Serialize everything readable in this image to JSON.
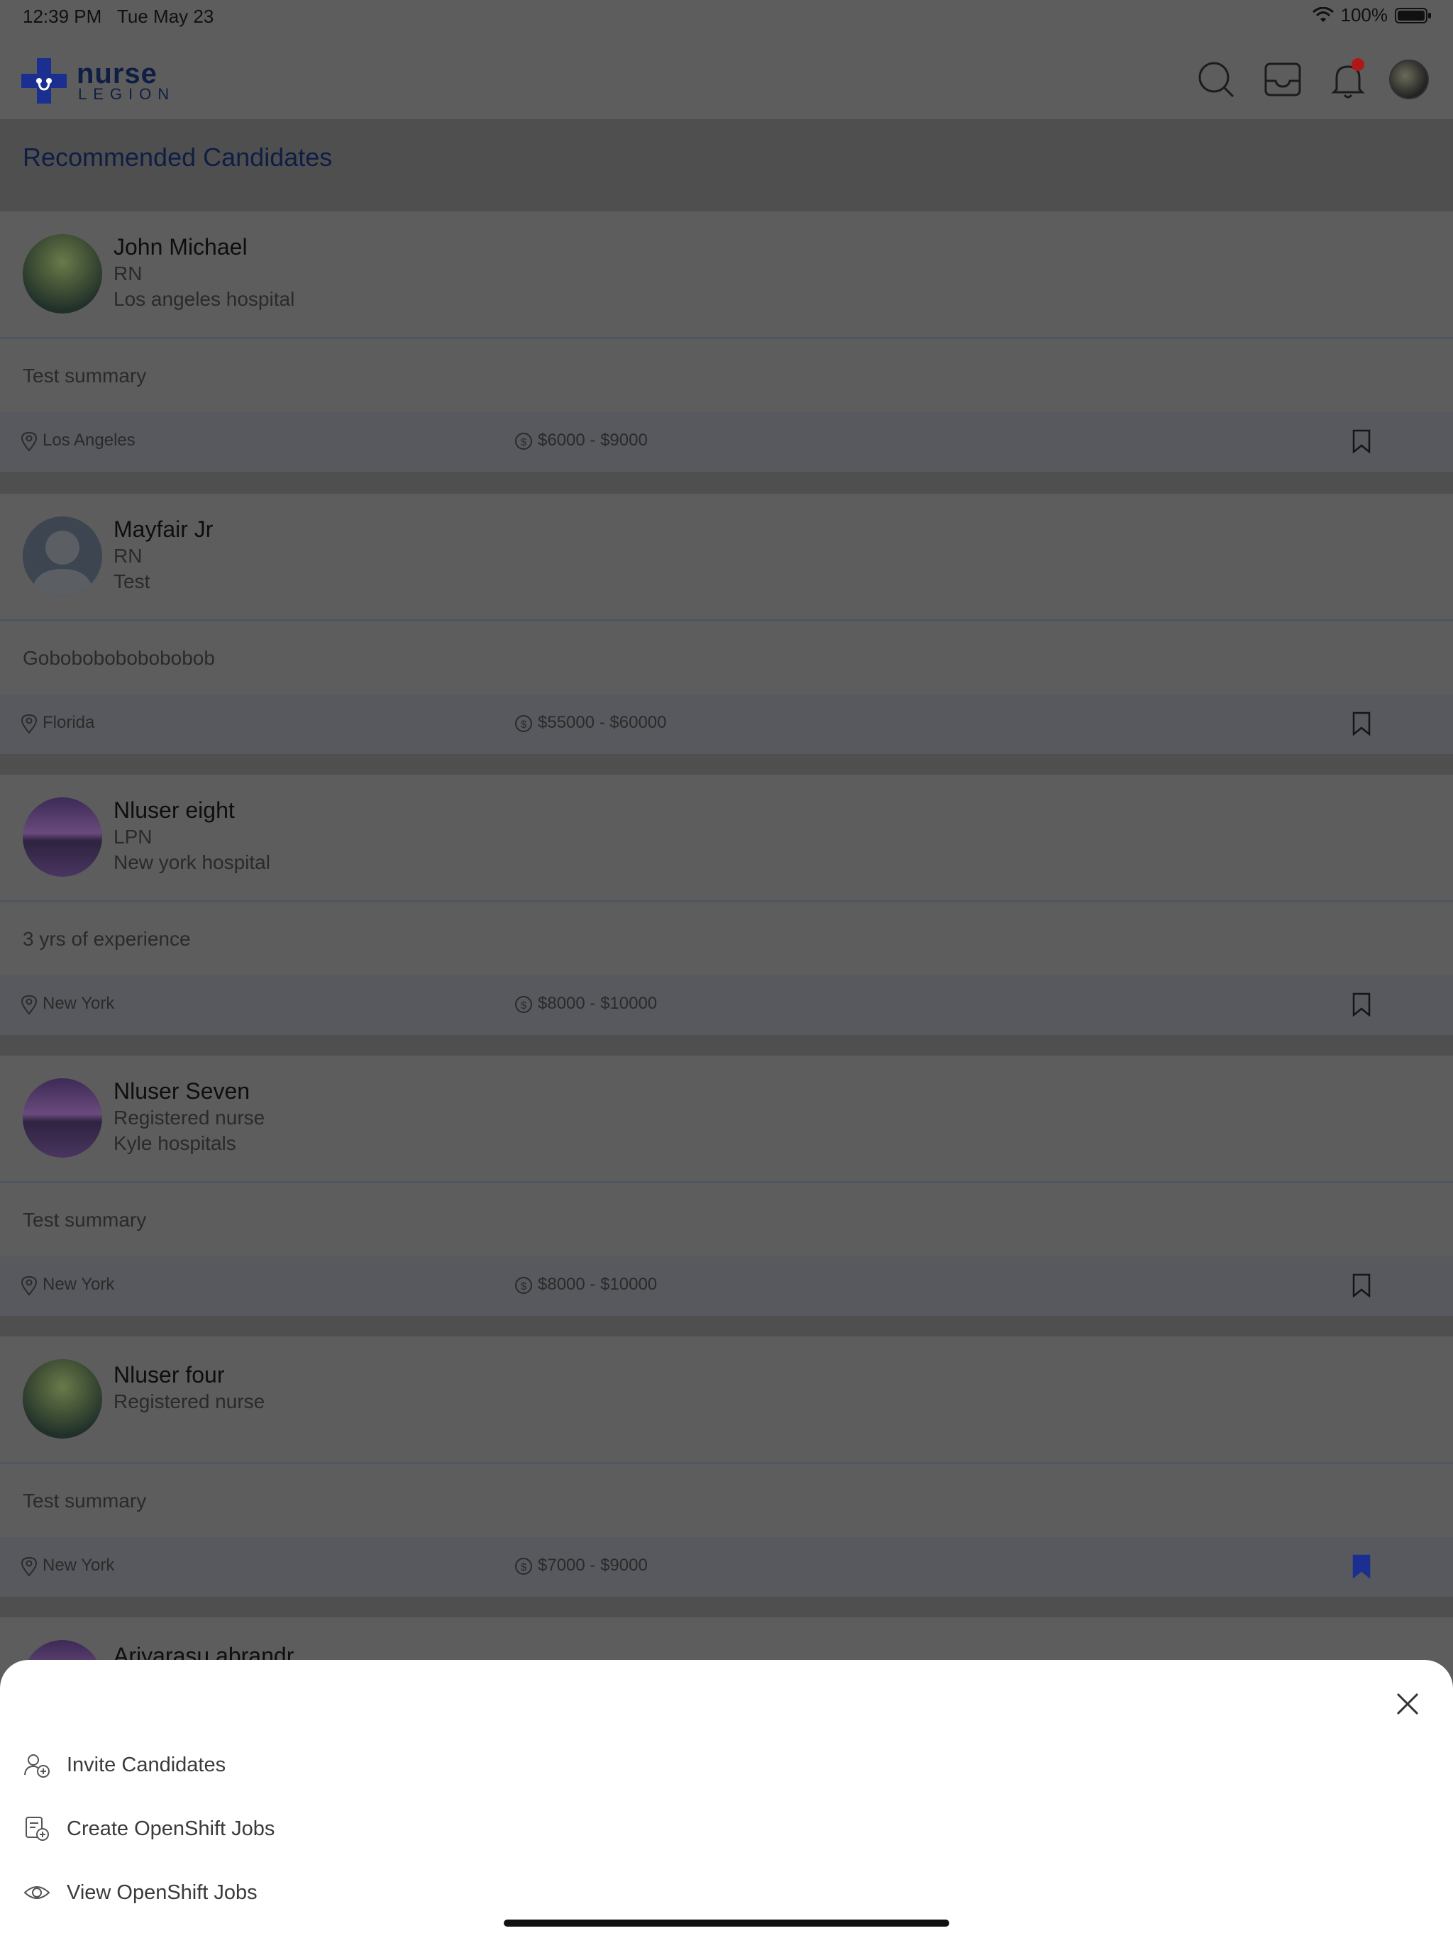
{
  "status_bar": {
    "time": "12:39 PM",
    "date": "Tue May 23",
    "battery": "100%"
  },
  "header": {
    "logo_line1": "nurse",
    "logo_line2": "LEGION",
    "icons": [
      "search-icon",
      "inbox-icon",
      "bell-icon",
      "profile-avatar"
    ]
  },
  "section": {
    "title": "Recommended Candidates"
  },
  "candidates": [
    {
      "name": "John Michael",
      "role": "RN",
      "org": "Los angeles hospital",
      "summary": "Test summary",
      "location": "Los Angeles",
      "salary": "$6000 - $9000",
      "bookmarked": false
    },
    {
      "name": "Mayfair Jr",
      "role": "RN",
      "org": "Test",
      "summary": "Gobobobobobobobob",
      "location": "Florida",
      "salary": "$55000 - $60000",
      "bookmarked": false
    },
    {
      "name": "Nluser eight",
      "role": "LPN",
      "org": "New york hospital",
      "summary": "3 yrs of experience",
      "location": "New York",
      "salary": "$8000 - $10000",
      "bookmarked": false
    },
    {
      "name": "Nluser Seven",
      "role": "Registered nurse",
      "org": "Kyle hospitals",
      "summary": "Test summary",
      "location": "New York",
      "salary": "$8000 - $10000",
      "bookmarked": false
    },
    {
      "name": "Nluser four",
      "role": "Registered nurse",
      "org": "",
      "summary": "Test summary",
      "location": "New York",
      "salary": "$7000 - $9000",
      "bookmarked": true
    },
    {
      "name": "Ariyarasu abrandr",
      "role": "",
      "org": "",
      "summary": "",
      "location": "",
      "salary": "",
      "bookmarked": false
    }
  ],
  "sheet": {
    "items": [
      {
        "label": "Invite Candidates",
        "icon": "invite-user-icon"
      },
      {
        "label": "Create OpenShift Jobs",
        "icon": "create-job-icon"
      },
      {
        "label": "View OpenShift Jobs",
        "icon": "eye-icon"
      }
    ]
  },
  "colors": {
    "brand": "#1f3fbf",
    "overlay_bg": "#5d5d5d",
    "bookmark_active": "#1a2f8f"
  }
}
